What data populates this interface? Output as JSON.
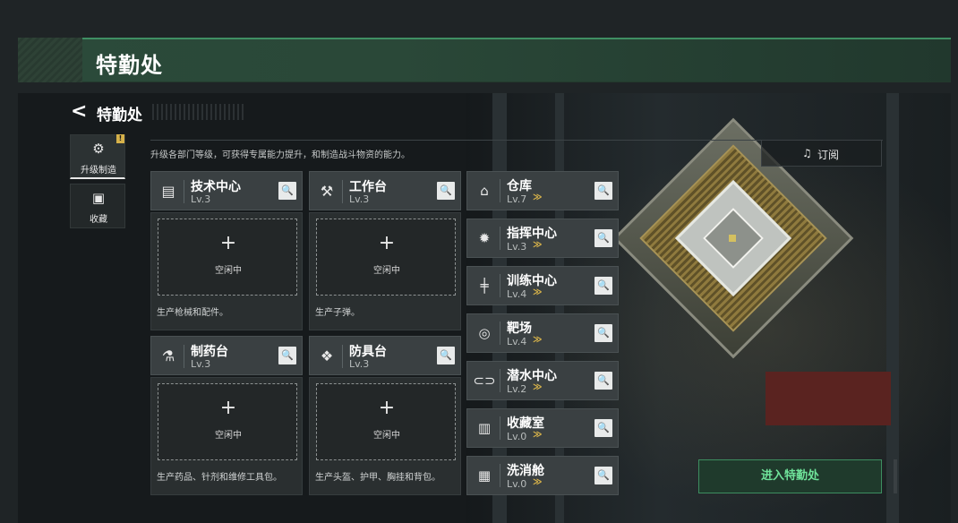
{
  "banner": {
    "title": "特勤处"
  },
  "header": {
    "title": "特勤处",
    "description": "升级各部门等级，可获得专属能力提升，和制造战斗物资的能力。"
  },
  "subscribe": {
    "label": "订阅",
    "icon": "subscribe-bell-icon"
  },
  "tabs": [
    {
      "label": "升级制造",
      "icon": "upgrade-gear-icon",
      "active": true,
      "badge": "!"
    },
    {
      "label": "收藏",
      "icon": "collection-cabinet-icon",
      "active": false
    }
  ],
  "cards": [
    {
      "name": "技术中心",
      "level": "Lv.3",
      "icon": "tech-center-icon",
      "slot": "空闲中",
      "desc": "生产枪械和配件。"
    },
    {
      "name": "工作台",
      "level": "Lv.3",
      "icon": "workbench-tools-icon",
      "slot": "空闲中",
      "desc": "生产子弹。"
    },
    {
      "name": "制药台",
      "level": "Lv.3",
      "icon": "microscope-icon",
      "slot": "空闲中",
      "desc": "生产药品、针剂和维修工具包。"
    },
    {
      "name": "防具台",
      "level": "Lv.3",
      "icon": "armor-cubes-icon",
      "slot": "空闲中",
      "desc": "生产头盔、护甲、胸挂和背包。"
    }
  ],
  "facilities": [
    {
      "name": "仓库",
      "level": "Lv.7",
      "icon": "warehouse-icon",
      "upgradable": true
    },
    {
      "name": "指挥中心",
      "level": "Lv.3",
      "icon": "command-chip-icon",
      "upgradable": true
    },
    {
      "name": "训练中心",
      "level": "Lv.4",
      "icon": "dumbbell-icon",
      "upgradable": true
    },
    {
      "name": "靶场",
      "level": "Lv.4",
      "icon": "target-icon",
      "upgradable": true
    },
    {
      "name": "潜水中心",
      "level": "Lv.2",
      "icon": "diving-mask-icon",
      "upgradable": true
    },
    {
      "name": "收藏室",
      "level": "Lv.0",
      "icon": "collection-room-icon",
      "upgradable": true
    },
    {
      "name": "洗消舱",
      "level": "Lv.0",
      "icon": "decontamination-icon",
      "upgradable": true
    }
  ],
  "slot": {
    "plus": "+"
  },
  "enter": {
    "label": "进入特勤处"
  },
  "glyphs": {
    "back": "<",
    "search": "🔍",
    "upgrade": "≫",
    "plus": "+"
  },
  "colors": {
    "accent_green": "#3f8f63",
    "enter_text": "#6fe39a",
    "upgrade_gold": "#d9b44a"
  }
}
